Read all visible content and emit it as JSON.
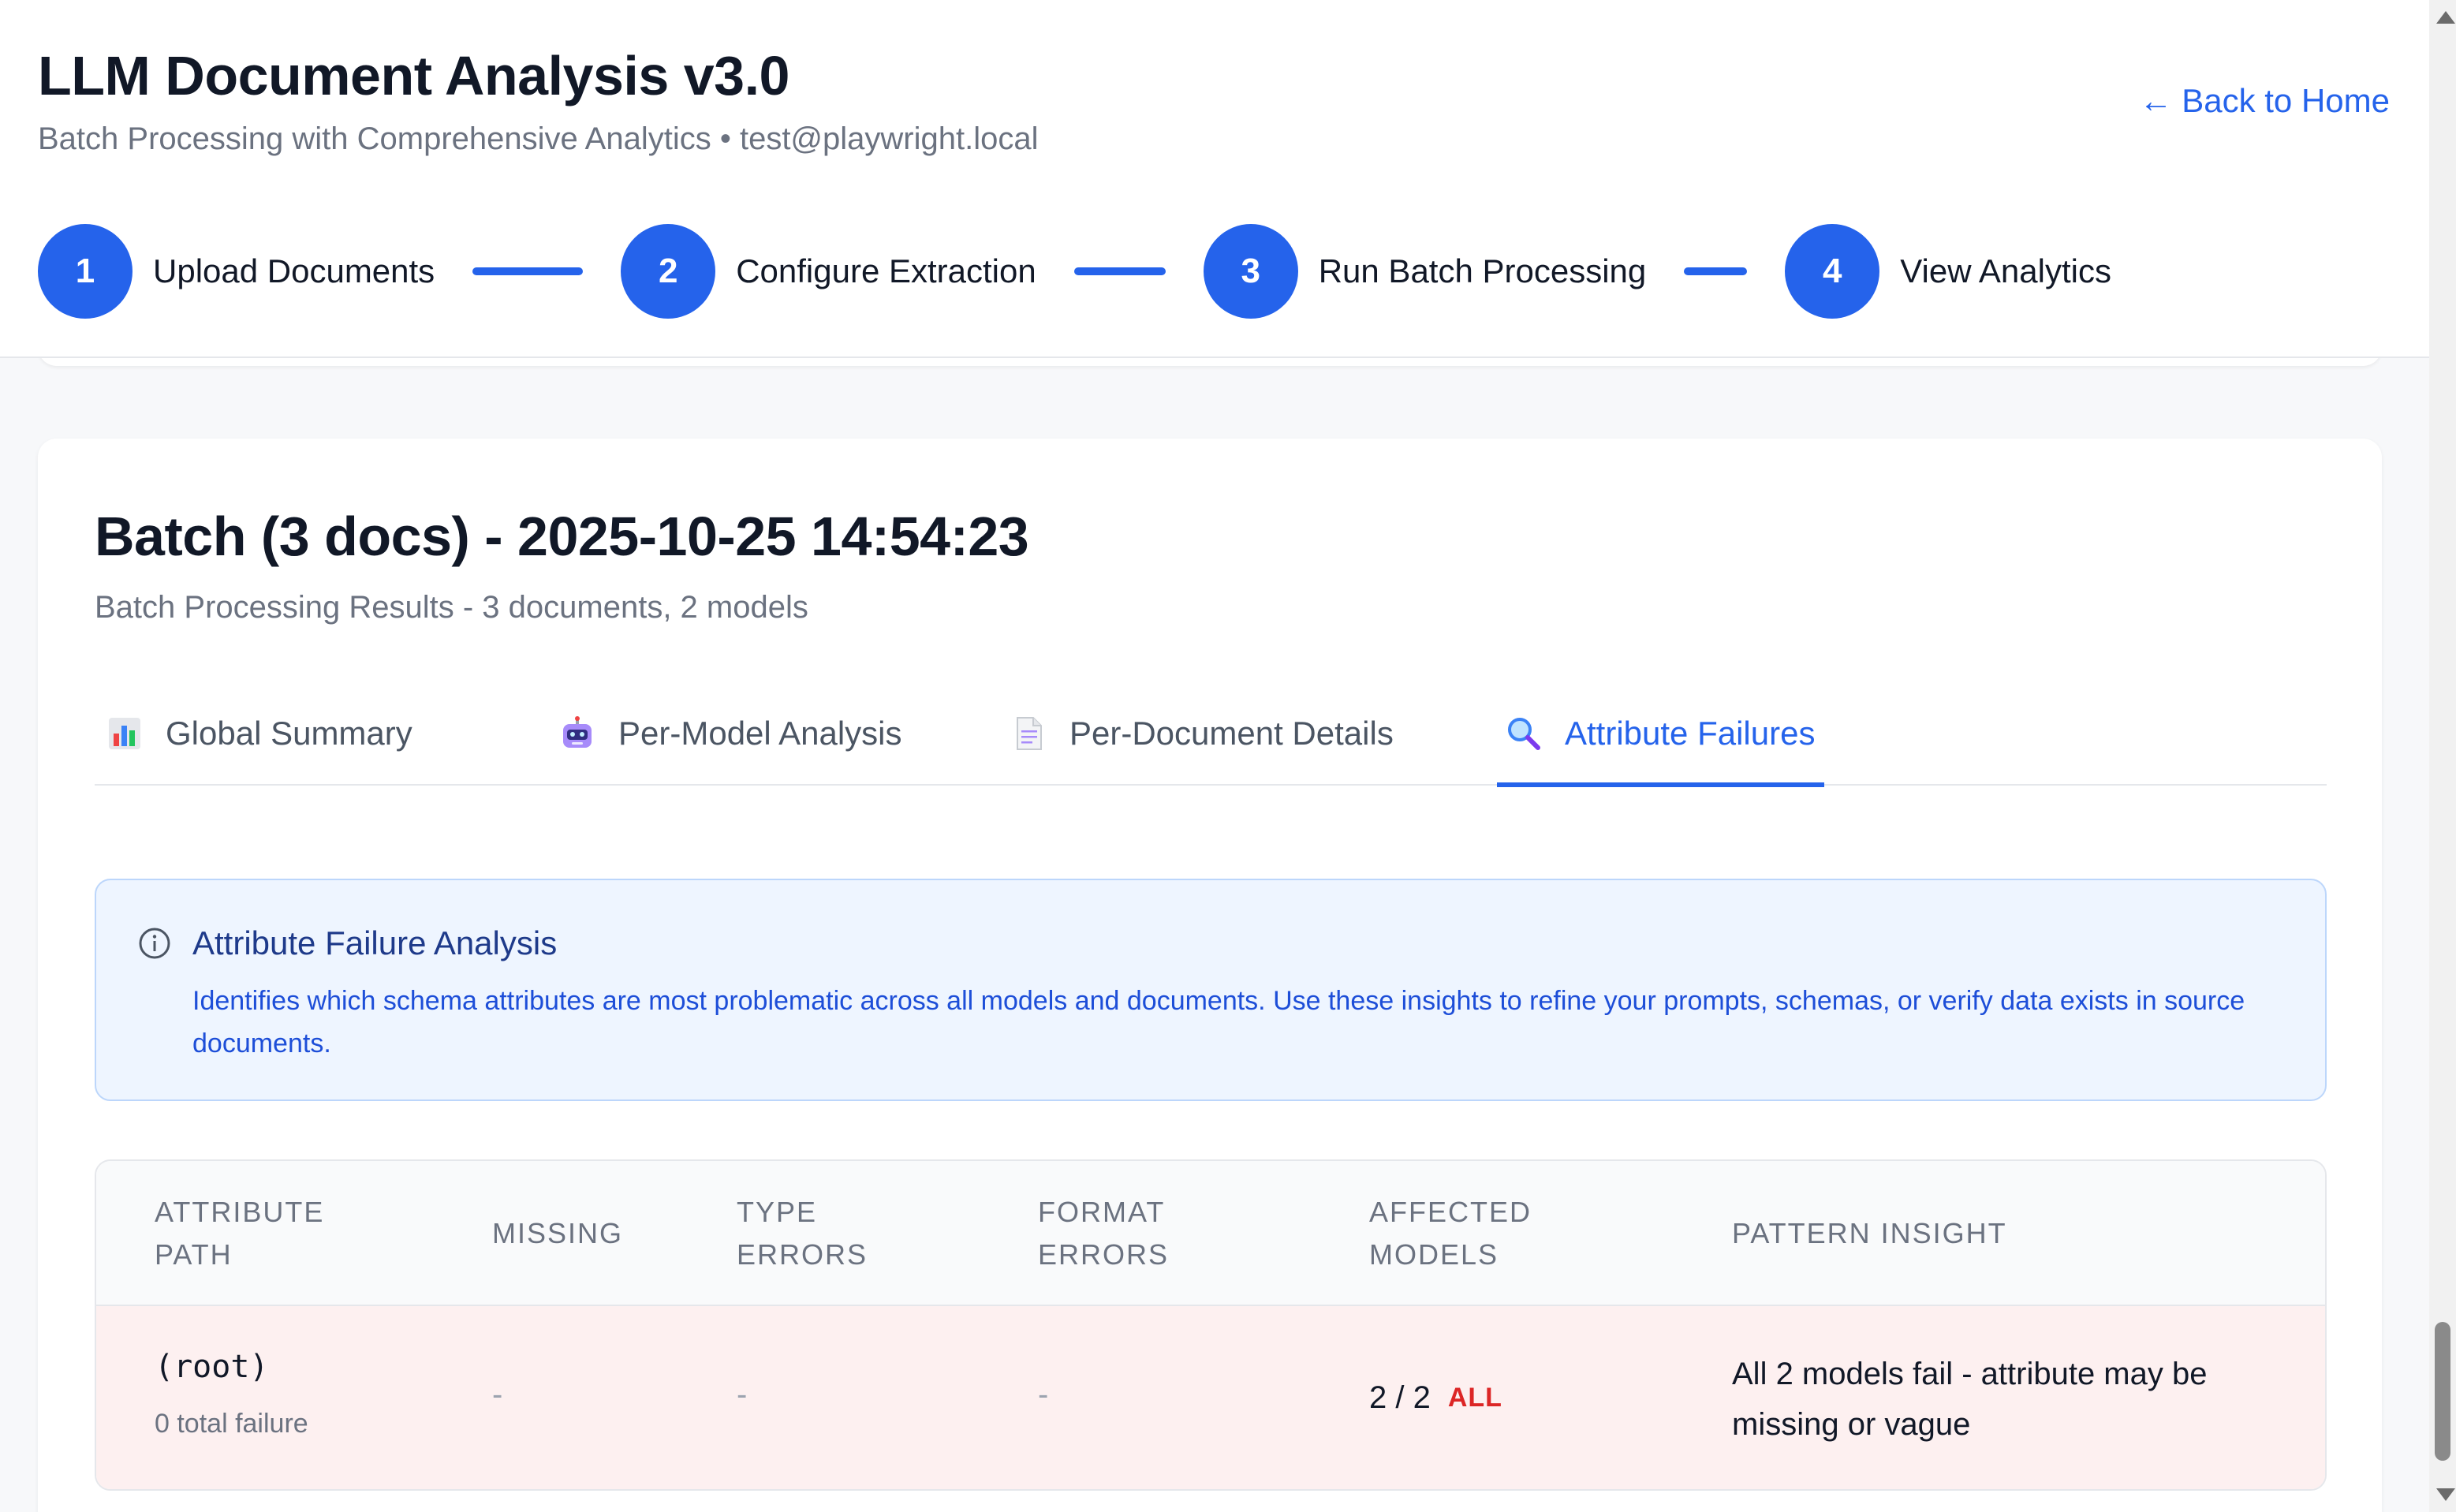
{
  "header": {
    "title": "LLM Document Analysis v3.0",
    "subtitle": "Batch Processing with Comprehensive Analytics • test@playwright.local",
    "back_link": "← Back to Home"
  },
  "stepper": {
    "steps": [
      {
        "number": "1",
        "label": "Upload Documents"
      },
      {
        "number": "2",
        "label": "Configure Extraction"
      },
      {
        "number": "3",
        "label": "Run Batch Processing"
      },
      {
        "number": "4",
        "label": "View Analytics"
      }
    ]
  },
  "batch": {
    "title": "Batch (3 docs) - 2025-10-25 14:54:23",
    "subtitle": "Batch Processing Results - 3 documents, 2 models"
  },
  "tabs": [
    {
      "label": "Global Summary",
      "icon": "bar-chart-icon",
      "active": false
    },
    {
      "label": "Per-Model Analysis",
      "icon": "robot-icon",
      "active": false
    },
    {
      "label": "Per-Document Details",
      "icon": "document-icon",
      "active": false
    },
    {
      "label": "Attribute Failures",
      "icon": "magnifier-icon",
      "active": true
    }
  ],
  "info": {
    "icon": "info-icon",
    "title": "Attribute Failure Analysis",
    "text": "Identifies which schema attributes are most problematic across all models and documents. Use these insights to refine your prompts, schemas, or verify data exists in source documents."
  },
  "table": {
    "headers": {
      "attribute_path": "ATTRIBUTE PATH",
      "missing": "MISSING",
      "type_errors": "TYPE ERRORS",
      "format_errors": "FORMAT ERRORS",
      "affected_models": "AFFECTED MODELS",
      "pattern_insight": "PATTERN INSIGHT"
    },
    "rows": [
      {
        "attribute_path": "(root)",
        "total_failure": "0 total failure",
        "missing": "-",
        "type_errors": "-",
        "format_errors": "-",
        "affected_models": "2 / 2",
        "affected_badge": "ALL",
        "pattern_insight": "All 2 models fail - attribute may be missing or vague"
      }
    ]
  },
  "colors": {
    "accent": "#2563eb",
    "info_bg": "#eef5ff",
    "failure_row_bg": "#fdf0f0",
    "badge_red": "#dc2626"
  }
}
